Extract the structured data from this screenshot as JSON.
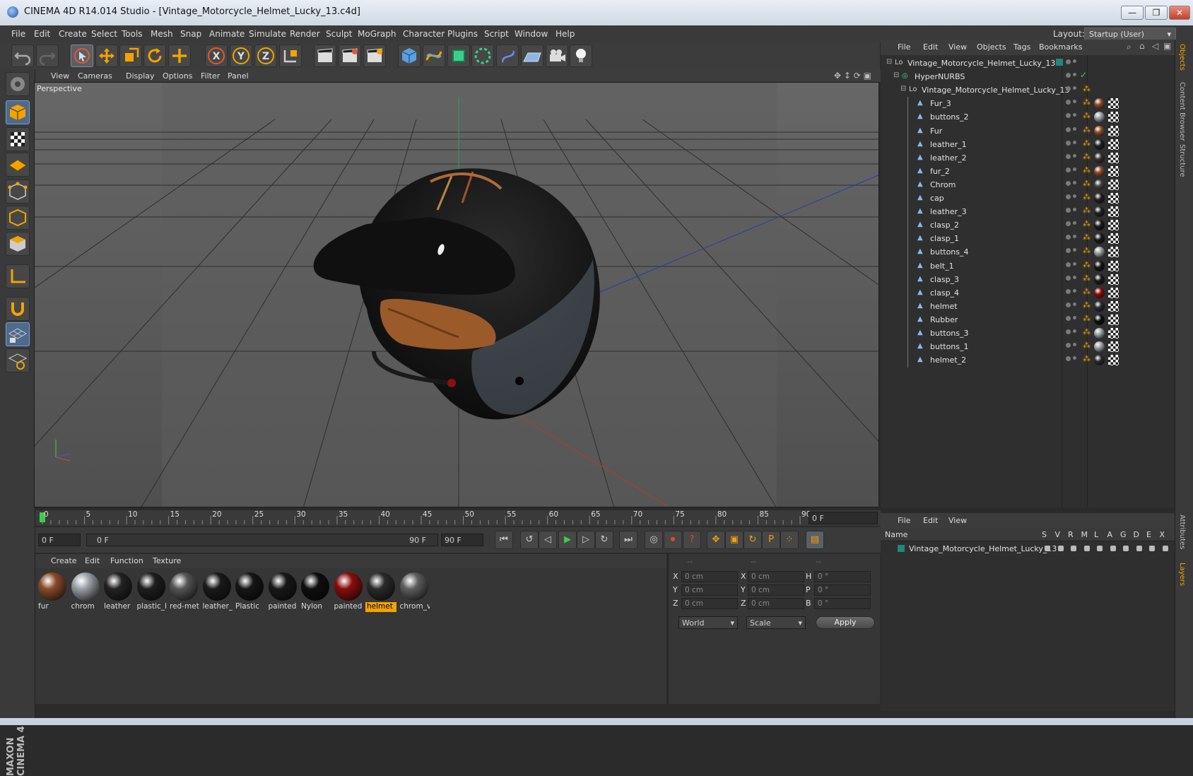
{
  "window": {
    "title": "CINEMA 4D R14.014 Studio - [Vintage_Motorcycle_Helmet_Lucky_13.c4d]",
    "buttons": {
      "minimize": "—",
      "restore": "❐",
      "close": "✕"
    }
  },
  "menubar": {
    "items": [
      "File",
      "Edit",
      "Create",
      "Select",
      "Tools",
      "Mesh",
      "Snap",
      "Animate",
      "Simulate",
      "Render",
      "Sculpt",
      "MoGraph",
      "Character",
      "Plugins",
      "Script",
      "Window",
      "Help"
    ],
    "layout_label": "Layout:",
    "layout_value": "Startup (User)"
  },
  "viewport": {
    "menu": [
      "View",
      "Cameras",
      "Display",
      "Options",
      "Filter",
      "Panel"
    ],
    "label": "Perspective"
  },
  "timeline": {
    "ticks": [
      "0",
      "5",
      "10",
      "15",
      "20",
      "25",
      "30",
      "35",
      "40",
      "45",
      "50",
      "55",
      "60",
      "65",
      "70",
      "75",
      "80",
      "85",
      "90"
    ],
    "current_frame": "0 F",
    "start_field": "0 F",
    "range_start": "0 F",
    "range_end": "90 F",
    "end_field": "90 F"
  },
  "material_manager": {
    "menu": [
      "Create",
      "Edit",
      "Function",
      "Texture"
    ],
    "materials": [
      {
        "label": "fur",
        "color": "#8a4a2a"
      },
      {
        "label": "chrom",
        "color": "#9aa0a6"
      },
      {
        "label": "leather",
        "color": "#222222"
      },
      {
        "label": "plastic_l",
        "color": "#1e1e1e"
      },
      {
        "label": "red-met",
        "color": "#555555"
      },
      {
        "label": "leather_",
        "color": "#1a1a1a"
      },
      {
        "label": "Plastic",
        "color": "#151515"
      },
      {
        "label": "painted",
        "color": "#181818"
      },
      {
        "label": "Nylon",
        "color": "#0e0e0e"
      },
      {
        "label": "painted",
        "color": "#8a0d0d"
      },
      {
        "label": "helmet",
        "color": "#2a2a2a"
      },
      {
        "label": "chrom_v",
        "color": "#5e5e5e"
      }
    ],
    "selected_index": 10
  },
  "coordinates": {
    "headers": [
      "--",
      "--",
      "--"
    ],
    "rows": [
      {
        "a": "X",
        "av": "0 cm",
        "b": "X",
        "bv": "0 cm",
        "c": "H",
        "cv": "0 °"
      },
      {
        "a": "Y",
        "av": "0 cm",
        "b": "Y",
        "bv": "0 cm",
        "c": "P",
        "cv": "0 °"
      },
      {
        "a": "Z",
        "av": "0 cm",
        "b": "Z",
        "bv": "0 cm",
        "c": "B",
        "cv": "0 °"
      }
    ],
    "mode1": "World",
    "mode2": "Scale",
    "apply": "Apply"
  },
  "object_manager": {
    "menu": [
      "File",
      "Edit",
      "View",
      "Objects",
      "Tags",
      "Bookmarks"
    ],
    "objects": [
      {
        "name": "Vintage_Motorcycle_Helmet_Lucky_13",
        "level": 0,
        "tag": ""
      },
      {
        "name": "HyperNURBS",
        "level": 1,
        "tag": ""
      },
      {
        "name": "Vintage_Motorcycle_Helmet_Lucky_13",
        "level": 2,
        "tag": ""
      },
      {
        "name": "Fur_3",
        "level": 3,
        "tag": "#8a4a2a"
      },
      {
        "name": "buttons_2",
        "level": 3,
        "tag": "#9aa0a6"
      },
      {
        "name": "Fur",
        "level": 3,
        "tag": "#8a4a2a"
      },
      {
        "name": "leather_1",
        "level": 3,
        "tag": "#222222"
      },
      {
        "name": "leather_2",
        "level": 3,
        "tag": "#333333"
      },
      {
        "name": "fur_2",
        "level": 3,
        "tag": "#8a4a2a"
      },
      {
        "name": "Chrom",
        "level": 3,
        "tag": "#444444"
      },
      {
        "name": "cap",
        "level": 3,
        "tag": "#222222"
      },
      {
        "name": "leather_3",
        "level": 3,
        "tag": "#222222"
      },
      {
        "name": "clasp_2",
        "level": 3,
        "tag": "#1a1a1a"
      },
      {
        "name": "clasp_1",
        "level": 3,
        "tag": "#1a1a1a"
      },
      {
        "name": "buttons_4",
        "level": 3,
        "tag": "#9aa0a6"
      },
      {
        "name": "belt_1",
        "level": 3,
        "tag": "#151515"
      },
      {
        "name": "clasp_3",
        "level": 3,
        "tag": "#1a1a1a"
      },
      {
        "name": "clasp_4",
        "level": 3,
        "tag": "#8a0d0d"
      },
      {
        "name": "helmet",
        "level": 3,
        "tag": "#2a2a2a"
      },
      {
        "name": "Rubber",
        "level": 3,
        "tag": "#0e0e0e"
      },
      {
        "name": "buttons_3",
        "level": 3,
        "tag": "#9aa0a6"
      },
      {
        "name": "buttons_1",
        "level": 3,
        "tag": "#9aa0a6"
      },
      {
        "name": "helmet_2",
        "level": 3,
        "tag": "#2a2a2a"
      }
    ]
  },
  "layer_manager": {
    "menu": [
      "File",
      "Edit",
      "View"
    ],
    "columns": [
      "Name",
      "S",
      "V",
      "R",
      "M",
      "L",
      "A",
      "G",
      "D",
      "E",
      "X"
    ],
    "rows": [
      "Vintage_Motorcycle_Helmet_Lucky_13"
    ]
  },
  "side_tabs": [
    "Objects",
    "Content Browser",
    "Structure",
    "Attributes",
    "Layers"
  ],
  "brand": "MAXON CINEMA 4D",
  "colors": {
    "accent": "#f3a300",
    "selection": "#4e6a8c",
    "layer": "#1f8a7a"
  }
}
